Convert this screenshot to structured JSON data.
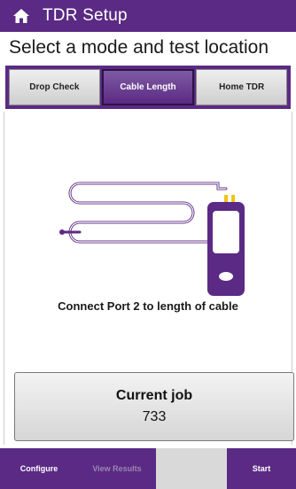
{
  "header": {
    "title": "TDR Setup",
    "icon": "home-icon"
  },
  "prompt": "Select a mode and test location",
  "modes": [
    {
      "label": "Drop Check",
      "active": false
    },
    {
      "label": "Cable Length",
      "active": true
    },
    {
      "label": "Home TDR",
      "active": false
    }
  ],
  "instruction": "Connect Port 2 to length of cable",
  "job": {
    "label": "Current job",
    "value": "733"
  },
  "bottom": {
    "configure": "Configure",
    "view_results": "View Results",
    "start": "Start"
  },
  "colors": {
    "brand": "#5b2a84",
    "connector": "#f2c21b"
  }
}
